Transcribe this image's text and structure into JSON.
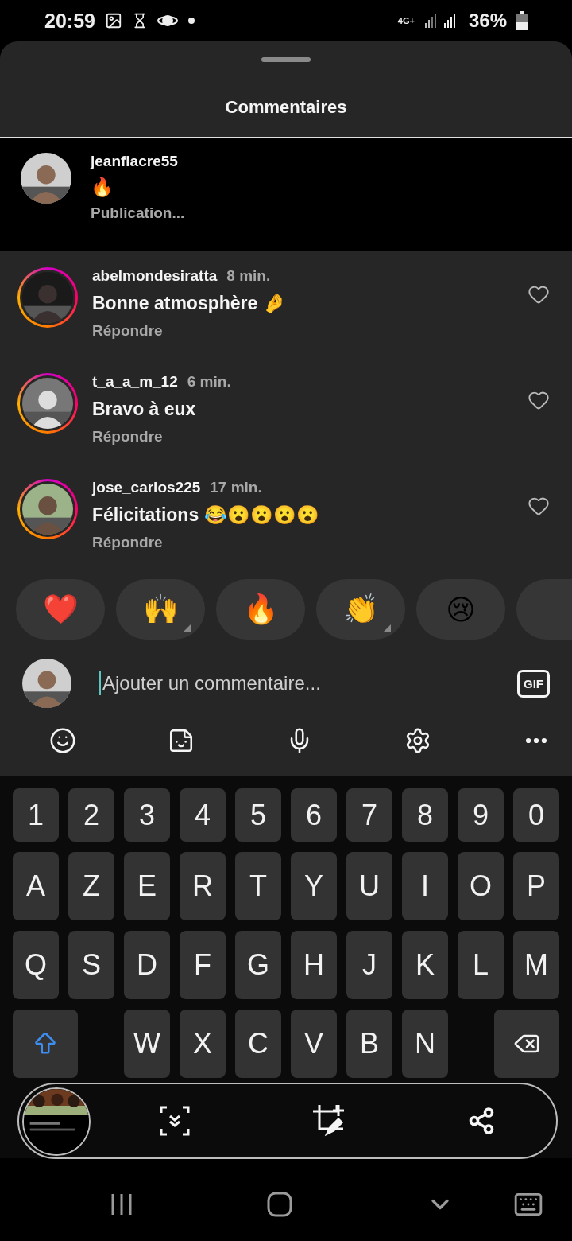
{
  "status_bar": {
    "time": "20:59",
    "network": "4G+",
    "battery": "36%"
  },
  "sheet": {
    "title": "Commentaires"
  },
  "caption": {
    "username": "jeanfiacre55",
    "text": "🔥",
    "status": "Publication..."
  },
  "comments": [
    {
      "username": "abelmondesiratta",
      "time": "8 min.",
      "text": "Bonne atmosphère 🤌",
      "reply": "Répondre",
      "liked": false
    },
    {
      "username": "t_a_a_m_12",
      "time": "6 min.",
      "text": "Bravo à eux",
      "reply": "Répondre",
      "liked": false
    },
    {
      "username": "jose_carlos225",
      "time": "17 min.",
      "text": "Félicitations 😂😮😮😮😮",
      "reply": "Répondre",
      "liked": false
    }
  ],
  "reactions": [
    {
      "emoji": "❤️",
      "variants": false
    },
    {
      "emoji": "🙌",
      "variants": true
    },
    {
      "emoji": "🔥",
      "variants": false
    },
    {
      "emoji": "👏",
      "variants": true
    },
    {
      "emoji": "😢",
      "variants": false
    }
  ],
  "composer": {
    "placeholder": "Ajouter un commentaire...",
    "gif": "GIF"
  },
  "keyboard": {
    "rows": [
      {
        "kind": "digits",
        "keys": [
          "1",
          "2",
          "3",
          "4",
          "5",
          "6",
          "7",
          "8",
          "9",
          "0"
        ]
      },
      {
        "kind": "letters",
        "keys": [
          "A",
          "Z",
          "E",
          "R",
          "T",
          "Y",
          "U",
          "I",
          "O",
          "P"
        ]
      },
      {
        "kind": "letters",
        "keys": [
          "Q",
          "S",
          "D",
          "F",
          "G",
          "H",
          "J",
          "K",
          "L",
          "M"
        ]
      },
      {
        "kind": "shift",
        "keys": [
          "W",
          "X",
          "C",
          "V",
          "B",
          "N"
        ]
      }
    ]
  }
}
